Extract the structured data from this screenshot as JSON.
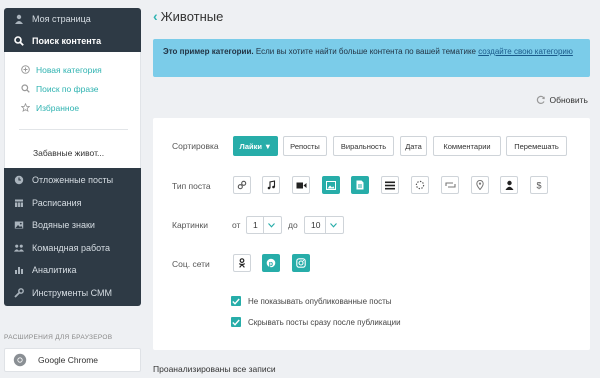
{
  "sidebar": {
    "top_items": [
      {
        "label": "Моя страница"
      },
      {
        "label": "Поиск контента"
      }
    ],
    "sub_items": [
      {
        "label": "Новая категория"
      },
      {
        "label": "Поиск по фразе"
      },
      {
        "label": "Избранное"
      }
    ],
    "favorite": "Забавные живот...",
    "bottom_items": [
      {
        "label": "Отложенные посты"
      },
      {
        "label": "Расписания"
      },
      {
        "label": "Водяные знаки"
      },
      {
        "label": "Командная работа"
      },
      {
        "label": "Аналитика"
      },
      {
        "label": "Инструменты СММ"
      }
    ],
    "extensions_label": "РАСШИРЕНИЯ ДЛЯ БРАУЗЕРОВ",
    "chrome_label": "Google Chrome"
  },
  "header": {
    "title": "Животные"
  },
  "info": {
    "bold": "Это пример категории.",
    "text": " Если вы хотите найти больше контента по вашей тематике ",
    "link": "создайте свою категорию"
  },
  "refresh_label": "Обновить",
  "filters": {
    "sort_label": "Сортировка",
    "sort_buttons": [
      "Лайки ▼",
      "Репосты",
      "Виральность",
      "Дата",
      "Комментарии",
      "Перемешать"
    ],
    "post_type_label": "Тип поста",
    "post_types": [
      "link-icon",
      "music-icon",
      "video-icon",
      "image-icon",
      "document-icon",
      "text-icon",
      "loading-icon",
      "repost-icon",
      "map-pin-icon",
      "user-icon",
      "dollar-icon"
    ],
    "pictures_label": "Картинки",
    "from_label": "от",
    "from_value": "1",
    "to_label": "до",
    "to_value": "10",
    "social_label": "Соц. сети",
    "socials": [
      "odnoklassniki-icon",
      "pinterest-icon",
      "instagram-icon"
    ],
    "check1": "Не показывать опубликованные посты",
    "check2": "Скрывать посты сразу после публикации"
  },
  "footer": "Проанализированы все записи",
  "colors": {
    "accent": "#27ada9",
    "sidebar": "#2e3a45",
    "info_bg": "#7bcce9"
  }
}
